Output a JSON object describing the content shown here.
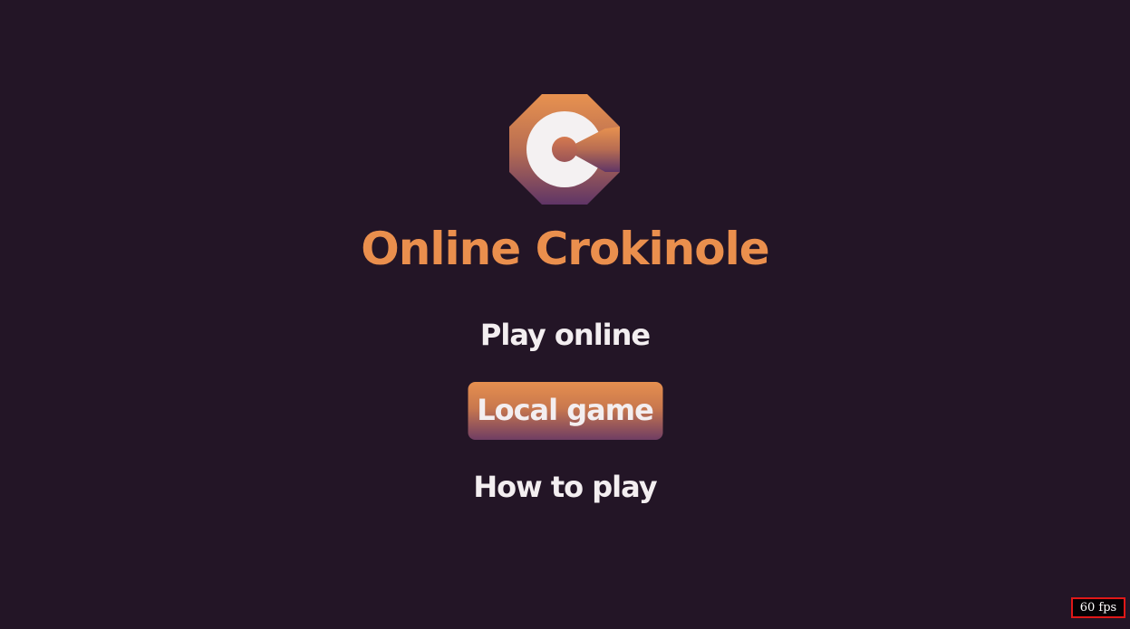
{
  "app": {
    "title": "Online Crokinole",
    "logo_icon": "crokinole-board-icon"
  },
  "colors": {
    "background": "#231526",
    "accent_orange": "#ea8f4d",
    "accent_purple": "#6f3d63",
    "text": "#f3eef0"
  },
  "menu": {
    "play_online": "Play online",
    "local_game": "Local game",
    "how_to_play": "How to play",
    "selected": "Local game"
  },
  "debug": {
    "fps": "60 fps"
  }
}
